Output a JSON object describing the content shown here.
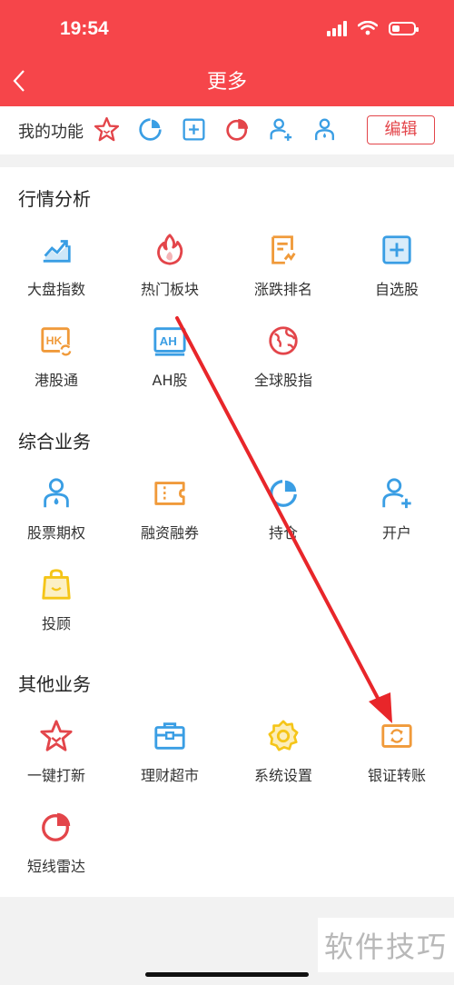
{
  "status_bar": {
    "time": "19:54",
    "battery_level": 0.35
  },
  "nav": {
    "title": "更多"
  },
  "my_functions": {
    "label": "我的功能",
    "icons": [
      "star-icon",
      "refresh-pie-icon",
      "plus-square-icon",
      "pie-chart-icon",
      "user-plus-icon",
      "user-drop-icon"
    ],
    "edit_label": "编辑"
  },
  "sections": [
    {
      "title": "行情分析",
      "items": [
        {
          "label": "大盘指数",
          "icon": "chart-trend-icon"
        },
        {
          "label": "热门板块",
          "icon": "flame-icon"
        },
        {
          "label": "涨跌排名",
          "icon": "document-icon"
        },
        {
          "label": "自选股",
          "icon": "plus-square-icon"
        },
        {
          "label": "港股通",
          "icon": "hk-exchange-icon"
        },
        {
          "label": "AH股",
          "icon": "ah-badge-icon"
        },
        {
          "label": "全球股指",
          "icon": "globe-icon"
        }
      ]
    },
    {
      "title": "综合业务",
      "items": [
        {
          "label": "股票期权",
          "icon": "user-drop-icon"
        },
        {
          "label": "融资融券",
          "icon": "ticket-icon"
        },
        {
          "label": "持仓",
          "icon": "pie-ring-icon"
        },
        {
          "label": "开户",
          "icon": "user-plus-icon"
        },
        {
          "label": "投顾",
          "icon": "shopping-bag-icon"
        }
      ]
    },
    {
      "title": "其他业务",
      "items": [
        {
          "label": "一键打新",
          "icon": "star-icon"
        },
        {
          "label": "理财超市",
          "icon": "briefcase-icon"
        },
        {
          "label": "系统设置",
          "icon": "gear-icon"
        },
        {
          "label": "银证转账",
          "icon": "transfer-icon"
        },
        {
          "label": "短线雷达",
          "icon": "pie-chart-icon"
        }
      ]
    }
  ],
  "watermark": "软件技巧",
  "colors": {
    "header": "#f6454a",
    "accent_red": "#e3454a",
    "blue": "#3a9ee4",
    "orange": "#f09a3a",
    "yellow": "#f5c518",
    "arrow": "#e8262a"
  }
}
